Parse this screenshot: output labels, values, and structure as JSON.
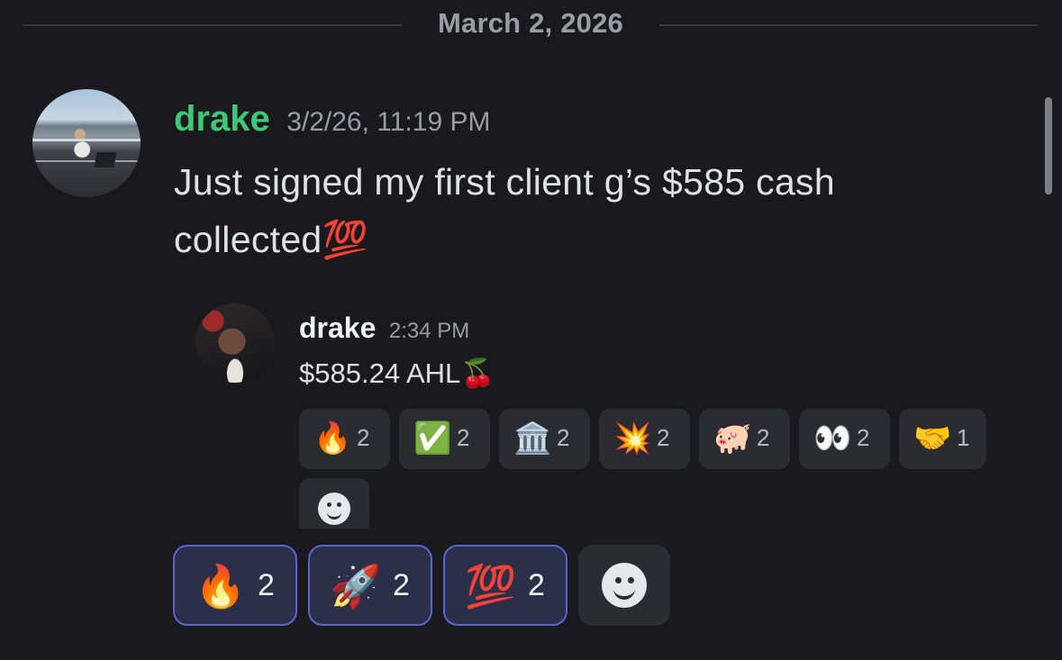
{
  "divider": {
    "date": "March 2, 2026"
  },
  "message": {
    "author": "drake",
    "timestamp": "3/2/26, 11:19 PM",
    "text": "Just signed my first client g’s $585 cash collected💯",
    "author_color": "#3ec774"
  },
  "reply": {
    "author": "drake",
    "timestamp": "2:34 PM",
    "text": "$585.24 AHL🍒"
  },
  "reply_reactions": [
    {
      "emoji": "🔥",
      "count": "2"
    },
    {
      "emoji": "✅",
      "count": "2"
    },
    {
      "emoji": "🏛️",
      "count": "2"
    },
    {
      "emoji": "💥",
      "count": "2"
    },
    {
      "emoji": "🐖",
      "count": "2"
    },
    {
      "emoji": "👀",
      "count": "2"
    },
    {
      "emoji": "🤝",
      "count": "1"
    }
  ],
  "message_reactions": [
    {
      "emoji": "🔥",
      "count": "2"
    },
    {
      "emoji": "🚀",
      "count": "2"
    },
    {
      "emoji": "💯",
      "count": "2"
    }
  ],
  "colors": {
    "background": "#1a1a1e",
    "active_reaction_border": "#5864d8",
    "active_reaction_bg": "#2c2f4a"
  }
}
